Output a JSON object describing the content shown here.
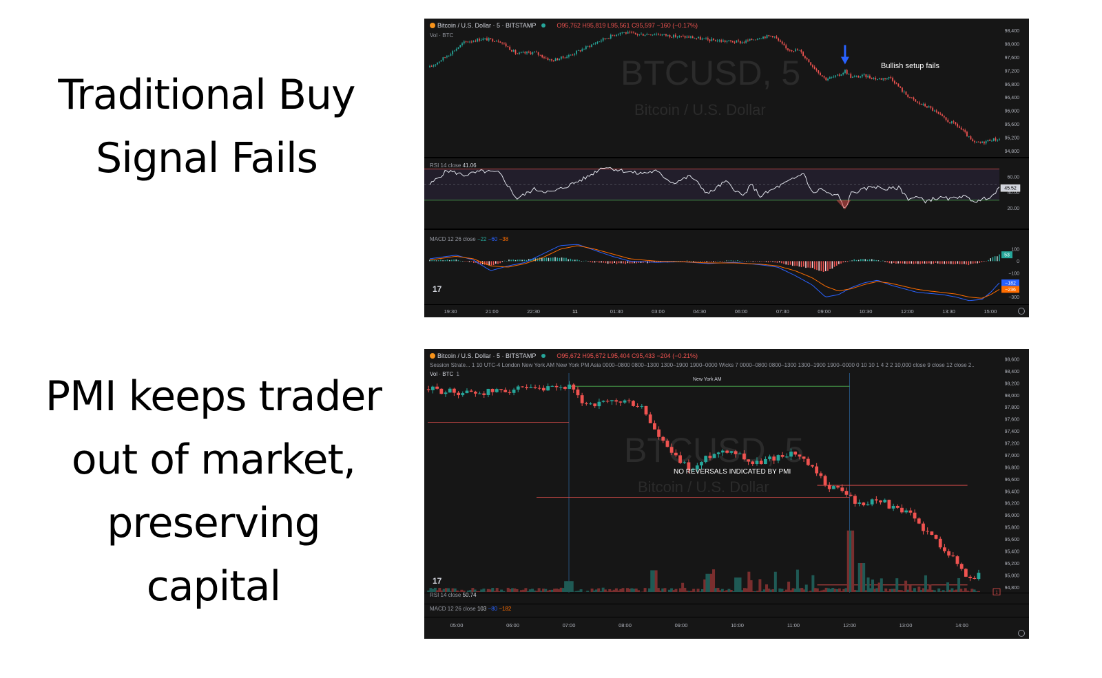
{
  "captions": {
    "top": [
      "Traditional Buy",
      "Signal Fails"
    ],
    "bottom": [
      "PMI keeps trader",
      "out of market,",
      "preserving",
      "capital"
    ]
  },
  "chart1": {
    "symbol": "Bitcoin / U.S. Dollar · 5 · BITSTAMP",
    "ohlc": "O95,762 H95,819 L95,561 C95,597 −160 (−0.17%)",
    "vol_label": "Vol · BTC",
    "watermark": "BTCUSD, 5",
    "watermark_sub": "Bitcoin / U.S. Dollar",
    "annotation": "Bullish setup fails",
    "rsi_header": "RSI 14 close",
    "rsi_value": "41.06",
    "rsi_last_label": "45.52",
    "macd_header": "MACD 12 26 close",
    "macd_values": [
      "−22",
      "−60",
      "−38"
    ],
    "macd_hist_label": "53",
    "macd_line_label": "−182",
    "macd_signal_label": "−236",
    "logo": "17",
    "colors": {
      "up": "#26a69a",
      "down": "#ef5350",
      "macd": "#2962ff",
      "signal": "#ff6d00",
      "arrow": "#2962ff"
    }
  },
  "chart2": {
    "symbol": "Bitcoin / U.S. Dollar · 5 · BITSTAMP",
    "ohlc": "O95,672 H95,672 L95,404 C95,433 −204 (−0.21%)",
    "session_line": "Session Strate... 1 10 UTC-4 London New York AM New York PM Asia 0000–0800 0800–1300 1300–1900 1900–0000 Wicks 7 0000–0800 0800–1300 1300–1900 1900–0000 0 10 10 1 4 2 2 10,000 close 9 close 12 close 2...",
    "vol_label": "Vol · BTC",
    "vol_value": "1",
    "watermark": "BTCUSD, 5",
    "watermark_sub": "Bitcoin / U.S. Dollar",
    "session_label": "New York AM",
    "annotation": "NO REVERSALS INDICATED BY PMI",
    "rsi_header": "RSI 14 close",
    "rsi_value": "50.74",
    "macd_header": "MACD 12 26 close",
    "macd_values": [
      "103",
      "−80",
      "−182"
    ],
    "price_tag": "1",
    "logo": "17",
    "colors": {
      "up": "#26a69a",
      "down": "#ef5350",
      "level": "#ef5350",
      "session": "#4caf50",
      "vline": "#26507a"
    }
  },
  "chart_data": [
    {
      "type": "candlestick",
      "title": "Bitcoin / U.S. Dollar · 5 · BITSTAMP",
      "x_ticks": [
        "19:30",
        "21:00",
        "22:30",
        "11",
        "01:30",
        "03:00",
        "04:30",
        "06:00",
        "07:30",
        "09:00",
        "10:30",
        "12:00",
        "13:30",
        "15:00"
      ],
      "y_ticks": [
        98400,
        98000,
        97600,
        97200,
        96800,
        96400,
        96000,
        95600,
        95200,
        94800
      ],
      "ylim": [
        94650,
        98550
      ],
      "price_path": [
        [
          0,
          97300
        ],
        [
          4,
          97650
        ],
        [
          8,
          98050
        ],
        [
          12,
          98150
        ],
        [
          16,
          98100
        ],
        [
          20,
          97700
        ],
        [
          24,
          97750
        ],
        [
          28,
          97500
        ],
        [
          32,
          97650
        ],
        [
          36,
          97900
        ],
        [
          40,
          98150
        ],
        [
          44,
          98350
        ],
        [
          48,
          98280
        ],
        [
          52,
          98300
        ],
        [
          56,
          98230
        ],
        [
          60,
          98200
        ],
        [
          64,
          98120
        ],
        [
          68,
          98080
        ],
        [
          72,
          98050
        ],
        [
          76,
          98200
        ],
        [
          79,
          98250
        ],
        [
          82,
          97850
        ],
        [
          85,
          97800
        ],
        [
          88,
          97350
        ],
        [
          91,
          96950
        ],
        [
          94,
          97050
        ],
        [
          95.5,
          97200
        ],
        [
          97,
          97000
        ],
        [
          100,
          97050
        ],
        [
          103,
          96950
        ],
        [
          106,
          97000
        ],
        [
          109,
          96550
        ],
        [
          112,
          96250
        ],
        [
          115,
          96100
        ],
        [
          117,
          95900
        ],
        [
          119,
          95700
        ],
        [
          121,
          95600
        ],
        [
          123,
          95350
        ],
        [
          125,
          95050
        ],
        [
          127,
          95050
        ],
        [
          129,
          95150
        ],
        [
          131,
          95150
        ]
      ],
      "rsi": {
        "levels": [
          70,
          30
        ],
        "y_ticks": [
          60,
          40,
          20
        ],
        "path": [
          [
            0,
            50
          ],
          [
            4,
            68
          ],
          [
            8,
            62
          ],
          [
            12,
            67
          ],
          [
            16,
            65
          ],
          [
            20,
            32
          ],
          [
            24,
            44
          ],
          [
            28,
            40
          ],
          [
            32,
            49
          ],
          [
            36,
            59
          ],
          [
            40,
            73
          ],
          [
            44,
            68
          ],
          [
            48,
            64
          ],
          [
            52,
            67
          ],
          [
            56,
            52
          ],
          [
            60,
            61
          ],
          [
            64,
            38
          ],
          [
            68,
            54
          ],
          [
            72,
            35
          ],
          [
            74,
            50
          ],
          [
            76,
            35
          ],
          [
            80,
            47
          ],
          [
            84,
            58
          ],
          [
            86,
            65
          ],
          [
            88,
            38
          ],
          [
            90,
            45
          ],
          [
            92,
            37
          ],
          [
            94,
            36
          ],
          [
            95.5,
            18
          ],
          [
            97,
            40
          ],
          [
            99,
            42
          ],
          [
            102,
            48
          ],
          [
            105,
            44
          ],
          [
            108,
            46
          ],
          [
            110,
            32
          ],
          [
            112,
            34
          ],
          [
            114,
            29
          ],
          [
            116,
            32
          ],
          [
            118,
            33
          ],
          [
            120,
            31
          ],
          [
            122,
            36
          ],
          [
            124,
            32
          ],
          [
            126,
            28
          ],
          [
            128,
            33
          ],
          [
            130,
            38
          ],
          [
            131,
            45.52
          ]
        ]
      },
      "macd": {
        "y_ticks": [
          100,
          0,
          -100,
          -300
        ],
        "macd_path": [
          [
            0,
            20
          ],
          [
            6,
            50
          ],
          [
            10,
            10
          ],
          [
            14,
            -80
          ],
          [
            18,
            -40
          ],
          [
            22,
            -10
          ],
          [
            26,
            60
          ],
          [
            30,
            130
          ],
          [
            34,
            140
          ],
          [
            38,
            90
          ],
          [
            42,
            40
          ],
          [
            46,
            0
          ],
          [
            52,
            -10
          ],
          [
            58,
            -5
          ],
          [
            64,
            -20
          ],
          [
            70,
            -10
          ],
          [
            76,
            -30
          ],
          [
            80,
            -50
          ],
          [
            84,
            -120
          ],
          [
            88,
            -200
          ],
          [
            91,
            -300
          ],
          [
            94,
            -280
          ],
          [
            97,
            -220
          ],
          [
            100,
            -180
          ],
          [
            103,
            -160
          ],
          [
            106,
            -200
          ],
          [
            109,
            -230
          ],
          [
            112,
            -260
          ],
          [
            115,
            -270
          ],
          [
            118,
            -280
          ],
          [
            121,
            -300
          ],
          [
            124,
            -330
          ],
          [
            127,
            -320
          ],
          [
            129,
            -260
          ],
          [
            131,
            -182
          ]
        ],
        "signal_path": [
          [
            0,
            10
          ],
          [
            6,
            40
          ],
          [
            10,
            20
          ],
          [
            14,
            -40
          ],
          [
            18,
            -50
          ],
          [
            22,
            -20
          ],
          [
            26,
            30
          ],
          [
            30,
            100
          ],
          [
            34,
            130
          ],
          [
            38,
            100
          ],
          [
            42,
            60
          ],
          [
            46,
            20
          ],
          [
            52,
            0
          ],
          [
            58,
            -5
          ],
          [
            64,
            -15
          ],
          [
            70,
            -15
          ],
          [
            76,
            -25
          ],
          [
            80,
            -40
          ],
          [
            84,
            -80
          ],
          [
            88,
            -140
          ],
          [
            91,
            -210
          ],
          [
            94,
            -250
          ],
          [
            97,
            -230
          ],
          [
            100,
            -195
          ],
          [
            103,
            -170
          ],
          [
            106,
            -185
          ],
          [
            109,
            -210
          ],
          [
            112,
            -235
          ],
          [
            115,
            -250
          ],
          [
            118,
            -262
          ],
          [
            121,
            -275
          ],
          [
            124,
            -300
          ],
          [
            127,
            -310
          ],
          [
            129,
            -280
          ],
          [
            131,
            -236
          ]
        ]
      }
    },
    {
      "type": "candlestick",
      "title": "Bitcoin / U.S. Dollar · 5 · BITSTAMP",
      "x_ticks": [
        "05:00",
        "06:00",
        "07:00",
        "08:00",
        "09:00",
        "10:00",
        "11:00",
        "12:00",
        "13:00",
        "14:00"
      ],
      "y_ticks": [
        98600,
        98400,
        98200,
        98000,
        97800,
        97600,
        97400,
        97200,
        97000,
        96800,
        96600,
        96400,
        96200,
        96000,
        95800,
        95600,
        95400,
        95200,
        95000,
        94800
      ],
      "ylim": [
        94700,
        98680
      ],
      "levels": [
        {
          "from": 0,
          "to": 2,
          "price": 97550
        },
        {
          "from": 2,
          "to": 7,
          "price": 96300
        },
        {
          "from": 7,
          "to": 9.1,
          "price": 96500
        },
        {
          "from": 7,
          "to": 9.1,
          "price": 94840
        }
      ],
      "session_box": {
        "label": "New York AM",
        "from": 2,
        "to": 7,
        "price": 98150
      },
      "price_path": [
        [
          -0.5,
          98100
        ],
        [
          0,
          98050
        ],
        [
          0.5,
          98050
        ],
        [
          1,
          98100
        ],
        [
          1.5,
          98080
        ],
        [
          2,
          98150
        ],
        [
          2.2,
          97900
        ],
        [
          2.5,
          97850
        ],
        [
          3,
          97900
        ],
        [
          3.3,
          97800
        ],
        [
          3.6,
          97300
        ],
        [
          3.9,
          96950
        ],
        [
          4.2,
          96750
        ],
        [
          4.5,
          97000
        ],
        [
          4.8,
          97100
        ],
        [
          5,
          97050
        ],
        [
          5.3,
          96850
        ],
        [
          5.6,
          96950
        ],
        [
          6,
          97050
        ],
        [
          6.3,
          96800
        ],
        [
          6.6,
          96500
        ],
        [
          6.9,
          96400
        ],
        [
          7.2,
          96150
        ],
        [
          7.5,
          96300
        ],
        [
          7.8,
          96100
        ],
        [
          8.1,
          96000
        ],
        [
          8.4,
          95700
        ],
        [
          8.7,
          95450
        ],
        [
          9.0,
          95100
        ],
        [
          9.1,
          94950
        ],
        [
          9.3,
          95000
        ]
      ],
      "volume_spikes": [
        [
          2,
          0.15
        ],
        [
          7,
          0.85
        ],
        [
          7.2,
          0.4
        ],
        [
          5,
          0.2
        ],
        [
          3.5,
          0.3
        ],
        [
          4.5,
          0.25
        ]
      ],
      "rsi": {
        "label": "RSI 14 close",
        "value": 50.74
      },
      "macd": {
        "label": "MACD 12 26 close",
        "values": [
          103,
          -80,
          -182
        ]
      }
    }
  ]
}
